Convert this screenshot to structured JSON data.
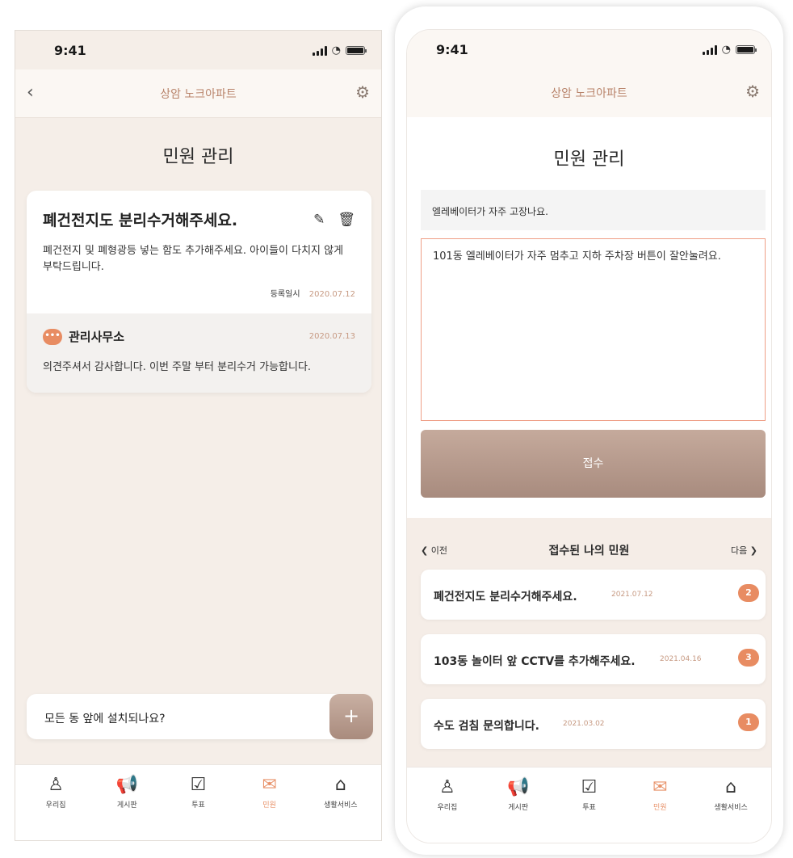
{
  "left": {
    "status_time": "9:41",
    "nav_title": "상암 노크아파트",
    "page_title": "민원 관리",
    "complaint": {
      "title": "폐건전지도 분리수거해주세요.",
      "body": "폐건전지 및 폐형광등 넣는 함도 추가해주세요. 아이들이 다치지 않게 부탁드립니다.",
      "meta_label": "등록일시",
      "meta_date": "2020.07.12"
    },
    "reply": {
      "author": "관리사무소",
      "date": "2020.07.13",
      "body": "의견주셔서 감사합니다. 이번 주말 부터 분리수거 가능합니다."
    },
    "comment_input_value": "모든 동 앞에 설치되나요?",
    "plus_label": "+"
  },
  "right": {
    "status_time": "9:41",
    "nav_title": "상암 노크아파트",
    "page_title": "민원 관리",
    "subject_value": "엘레베이터가 자주 고장나요.",
    "content_value": "101동 엘레베이터가 자주 멈추고 지하 주차장 버튼이 잘안눌려요.",
    "submit_label": "접수",
    "list": {
      "prev_label": "❮ 이전",
      "next_label": "다음 ❯",
      "title": "접수된 나의 민원",
      "items": [
        {
          "title": "폐건전지도 분리수거해주세요.",
          "date": "2021.07.12",
          "badge": "2"
        },
        {
          "title": "103동 놀이터 앞 CCTV를 추가해주세요.",
          "date": "2021.04.16",
          "badge": "3"
        },
        {
          "title": "수도 검침 문의합니다.",
          "date": "2021.03.02",
          "badge": "1"
        }
      ]
    }
  },
  "tabs": [
    {
      "label": "우리집",
      "icon": "person-icon",
      "glyph": "♙"
    },
    {
      "label": "게시판",
      "icon": "megaphone-icon",
      "glyph": "📢"
    },
    {
      "label": "투표",
      "icon": "vote-icon",
      "glyph": "☑"
    },
    {
      "label": "민원",
      "icon": "mail-icon",
      "glyph": "✉"
    },
    {
      "label": "생활서비스",
      "icon": "home-service-icon",
      "glyph": "⌂"
    }
  ],
  "active_tab_color": "#e8936b",
  "accent_color": "#e88c62"
}
